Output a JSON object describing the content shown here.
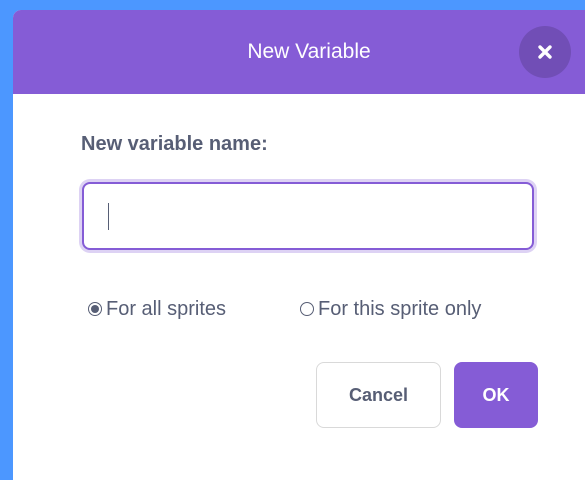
{
  "dialog": {
    "title": "New Variable",
    "close_icon": "close-icon"
  },
  "form": {
    "label": "New variable name:",
    "input_value": "",
    "input_placeholder": ""
  },
  "scope": {
    "options": [
      {
        "label": "For all sprites",
        "checked": true
      },
      {
        "label": "For this sprite only",
        "checked": false
      }
    ]
  },
  "buttons": {
    "cancel_label": "Cancel",
    "ok_label": "OK"
  },
  "colors": {
    "accent": "#855cd6",
    "backdrop": "#4c97ff",
    "text": "#575e75"
  }
}
